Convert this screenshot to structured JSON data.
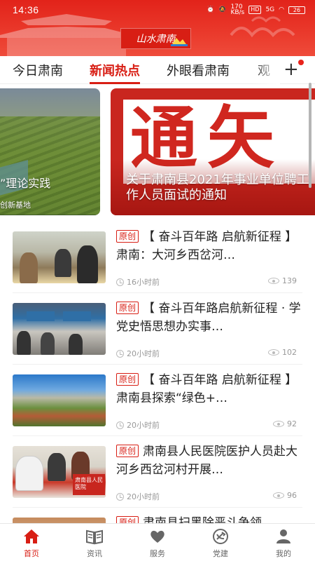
{
  "status_bar": {
    "time": "14:36",
    "network_speed": "170\nKB/s",
    "hd_label": "HD",
    "signal_label": "5G",
    "battery": "26"
  },
  "header": {
    "logo_text": "山水肃南"
  },
  "tabs": [
    {
      "label": "今日肃南",
      "active": false
    },
    {
      "label": "新闻热点",
      "active": true
    },
    {
      "label": "外眼看肃南",
      "active": false
    },
    {
      "label": "观",
      "active": false
    }
  ],
  "tab_add_icon": "plus-icon",
  "carousel": [
    {
      "caption": "”理论实践",
      "sub_caption": "创新基地"
    },
    {
      "big_text": "通矢",
      "caption": "关于肃南县2021年事业单位聘工作人员面试的通知"
    }
  ],
  "news": [
    {
      "tag": "原创",
      "title": "【 奋斗百年路 启航新征程 】肃南：大河乡西岔河…",
      "time": "16小时前",
      "views": "139"
    },
    {
      "tag": "原创",
      "title": "【 奋斗百年路启航新征程 · 学党史悟思想办实事…",
      "time": "20小时前",
      "views": "102"
    },
    {
      "tag": "原创",
      "title": "【 奋斗百年路 启航新征程 】肃南县探索“绿色+…",
      "time": "20小时前",
      "views": "92"
    },
    {
      "tag": "原创",
      "title": "肃南县人民医院医护人员赴大河乡西岔河村开展…",
      "time": "20小时前",
      "views": "96"
    },
    {
      "tag": "原创",
      "title": "肃南县扫黑除恶斗争领",
      "time": "",
      "views": ""
    }
  ],
  "thumb_banner_text": "肃南县人民医院",
  "bottom_nav": [
    {
      "label": "首页",
      "icon": "home-icon",
      "active": true
    },
    {
      "label": "资讯",
      "icon": "news-icon",
      "active": false
    },
    {
      "label": "服务",
      "icon": "heart-icon",
      "active": false
    },
    {
      "label": "党建",
      "icon": "party-emblem-icon",
      "active": false
    },
    {
      "label": "我的",
      "icon": "user-icon",
      "active": false
    }
  ],
  "colors": {
    "brand_red": "#d81e14",
    "muted": "#999999"
  }
}
